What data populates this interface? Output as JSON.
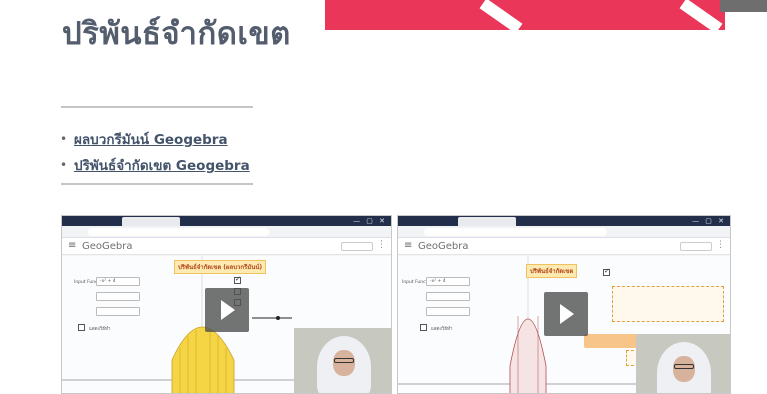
{
  "slide": {
    "title": "ปริพันธ์จำกัดเขต",
    "links": [
      {
        "label": "ผลบวกรีมันน์ Geogebra"
      },
      {
        "label": "ปริพันธ์จำกัดเขต Geogebra"
      }
    ],
    "bullet": "•"
  },
  "videos": [
    {
      "app_title": "GeoGebra",
      "heading": "ปริพันธ์จำกัดเขต (ผลบวกรีมันน์)",
      "function_label": "Input Function",
      "function_value": "-x² + 4",
      "checkbox_label": "แสดงวิธีทำ",
      "play_icon": "play-icon",
      "webcam": "presenter-webcam"
    },
    {
      "app_title": "GeoGebra",
      "heading": "ปริพันธ์จำกัดเขต",
      "function_label": "Input Function",
      "function_value": "-x² + 4",
      "checkbox_label": "แสดงวิธีทำ",
      "play_icon": "play-icon",
      "webcam": "presenter-webcam"
    }
  ],
  "colors": {
    "title": "#535d6e",
    "accent_band": "#ea3658",
    "link": "#44546a",
    "area_fill": "#f6d545"
  }
}
